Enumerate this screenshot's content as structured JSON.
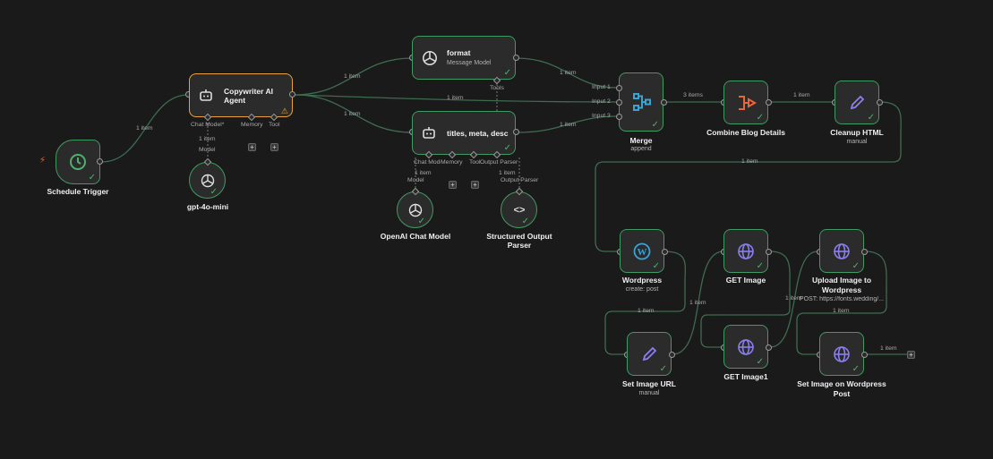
{
  "colors": {
    "background": "#1a1a1a",
    "node_fill": "#2b2b2b",
    "success_border": "#3f9b62",
    "selected_border": "#e9a23b",
    "edge": "#3e6b51",
    "trigger_icon": "#4fb06e",
    "merge_icon": "#3aa3d6",
    "combine_icon": "#e9663b",
    "pencil_icon": "#8b7ff0",
    "globe_icon": "#8b7ff0"
  },
  "nodes": {
    "schedule": {
      "title": "Schedule Trigger",
      "icon": "clock-icon"
    },
    "copywriter": {
      "title_line1": "Copywriter AI",
      "title_line2": "Agent",
      "icon": "robot-icon",
      "port_chat": "Chat Model*",
      "port_memory": "Memory",
      "port_tool": "Tool"
    },
    "gpt4o": {
      "title": "gpt-4o-mini",
      "icon": "openai-icon"
    },
    "format": {
      "title": "format",
      "subtitle": "Message Model",
      "icon": "openai-icon",
      "port_tools": "Tools"
    },
    "titles": {
      "title": "titles, meta, desc",
      "icon": "robot-icon",
      "port_chat": "Chat Model",
      "port_memory": "Memory",
      "port_tool": "Tool",
      "port_parser": "Output Parser"
    },
    "openai_chat": {
      "title": "OpenAI Chat Model",
      "icon": "openai-icon"
    },
    "parser": {
      "title_line1": "Structured Output",
      "title_line2": "Parser",
      "icon": "code-brackets-icon"
    },
    "merge": {
      "title": "Merge",
      "subtitle": "append",
      "icon": "merge-icon",
      "input1": "Input 1",
      "input2": "Input 2",
      "input3": "Input 3"
    },
    "combine": {
      "title": "Combine Blog Details",
      "icon": "combine-icon"
    },
    "cleanup": {
      "title": "Cleanup HTML",
      "subtitle": "manual",
      "icon": "pencil-icon"
    },
    "wordpress": {
      "title": "Wordpress",
      "subtitle": "create: post",
      "icon": "wordpress-icon"
    },
    "setimg": {
      "title": "Set Image URL",
      "subtitle": "manual",
      "icon": "pencil-icon"
    },
    "getimg": {
      "title": "GET Image",
      "icon": "globe-icon"
    },
    "getimg1": {
      "title": "GET Image1",
      "icon": "globe-icon"
    },
    "upload": {
      "title_line1": "Upload Image to",
      "title_line2": "Wordpress",
      "subtitle": "POST: https://fonts.wedding/...",
      "icon": "globe-icon"
    },
    "setwp": {
      "title_line1": "Set Image on Wordpress",
      "title_line2": "Post",
      "icon": "globe-icon"
    }
  },
  "edges": {
    "sched_agent": "1 item",
    "agent_format": "1 item",
    "agent_merge": "1 item",
    "agent_titles": "1 item",
    "gpt_agent": "1 item",
    "gpt_model": "Model",
    "format_merge": "1 item",
    "titles_merge": "1 item",
    "openai_titles": "1 item",
    "openai_model": "Model",
    "parser_titles": "1 item",
    "parser_label": "Output Parser",
    "merge_combine": "3 items",
    "combine_cleanup": "1 item",
    "cleanup_wp": "1 item",
    "wp_setimg": "1 item",
    "setimg_get": "1 item",
    "get1_upload": "1 item",
    "upload_setwp": "1 item",
    "setwp_out": "1 item"
  }
}
